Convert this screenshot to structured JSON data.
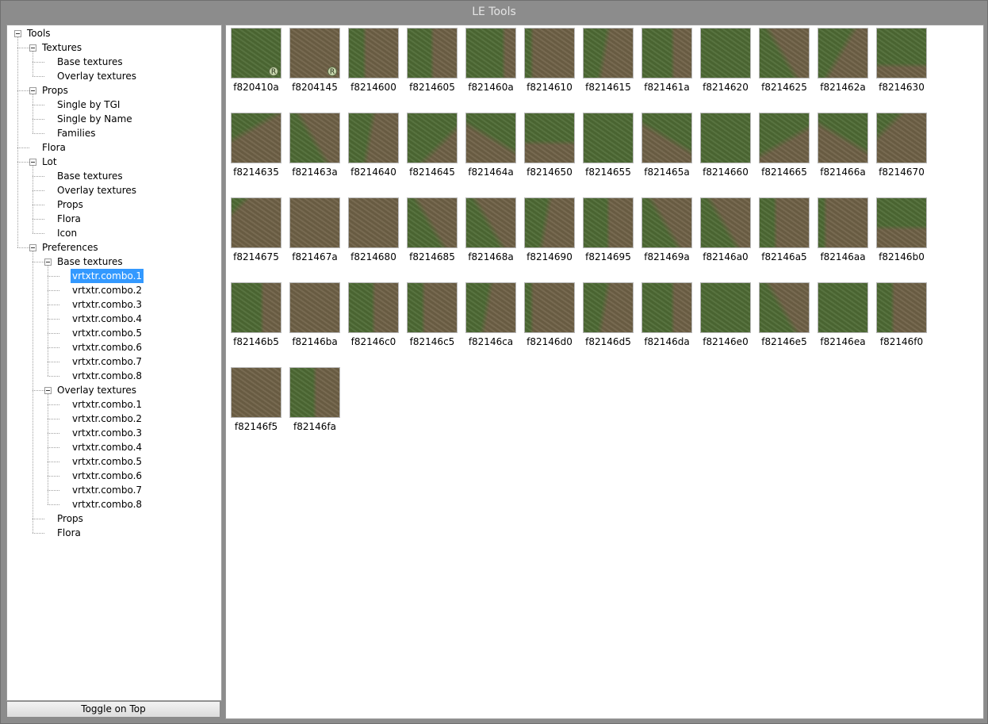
{
  "window": {
    "title": "LE Tools"
  },
  "toggle_button": {
    "label": "Toggle on Top"
  },
  "tree": [
    {
      "id": "tools",
      "label": "Tools",
      "level": 0,
      "expanded": true
    },
    {
      "id": "textures",
      "label": "Textures",
      "level": 1,
      "expanded": true
    },
    {
      "id": "textures-base",
      "label": "Base textures",
      "level": 2
    },
    {
      "id": "textures-overlay",
      "label": "Overlay textures",
      "level": 2
    },
    {
      "id": "props",
      "label": "Props",
      "level": 1,
      "expanded": true
    },
    {
      "id": "props-tgi",
      "label": "Single by TGI",
      "level": 2
    },
    {
      "id": "props-name",
      "label": "Single by Name",
      "level": 2
    },
    {
      "id": "props-families",
      "label": "Families",
      "level": 2
    },
    {
      "id": "flora",
      "label": "Flora",
      "level": 1
    },
    {
      "id": "lot",
      "label": "Lot",
      "level": 1,
      "expanded": true
    },
    {
      "id": "lot-base",
      "label": "Base textures",
      "level": 2
    },
    {
      "id": "lot-overlay",
      "label": "Overlay textures",
      "level": 2
    },
    {
      "id": "lot-props",
      "label": "Props",
      "level": 2
    },
    {
      "id": "lot-flora",
      "label": "Flora",
      "level": 2
    },
    {
      "id": "lot-icon",
      "label": "Icon",
      "level": 2
    },
    {
      "id": "prefs",
      "label": "Preferences",
      "level": 1,
      "expanded": true
    },
    {
      "id": "prefs-base",
      "label": "Base textures",
      "level": 2,
      "expanded": true
    },
    {
      "id": "pb1",
      "label": "vrtxtr.combo.1",
      "level": 3,
      "selected": true
    },
    {
      "id": "pb2",
      "label": "vrtxtr.combo.2",
      "level": 3
    },
    {
      "id": "pb3",
      "label": "vrtxtr.combo.3",
      "level": 3
    },
    {
      "id": "pb4",
      "label": "vrtxtr.combo.4",
      "level": 3
    },
    {
      "id": "pb5",
      "label": "vrtxtr.combo.5",
      "level": 3
    },
    {
      "id": "pb6",
      "label": "vrtxtr.combo.6",
      "level": 3
    },
    {
      "id": "pb7",
      "label": "vrtxtr.combo.7",
      "level": 3
    },
    {
      "id": "pb8",
      "label": "vrtxtr.combo.8",
      "level": 3
    },
    {
      "id": "prefs-overlay",
      "label": "Overlay textures",
      "level": 2,
      "expanded": true
    },
    {
      "id": "po1",
      "label": "vrtxtr.combo.1",
      "level": 3
    },
    {
      "id": "po2",
      "label": "vrtxtr.combo.2",
      "level": 3
    },
    {
      "id": "po3",
      "label": "vrtxtr.combo.3",
      "level": 3
    },
    {
      "id": "po4",
      "label": "vrtxtr.combo.4",
      "level": 3
    },
    {
      "id": "po5",
      "label": "vrtxtr.combo.5",
      "level": 3
    },
    {
      "id": "po6",
      "label": "vrtxtr.combo.6",
      "level": 3
    },
    {
      "id": "po7",
      "label": "vrtxtr.combo.7",
      "level": 3
    },
    {
      "id": "po8",
      "label": "vrtxtr.combo.8",
      "level": 3
    },
    {
      "id": "prefs-props",
      "label": "Props",
      "level": 2
    },
    {
      "id": "prefs-flora",
      "label": "Flora",
      "level": 2
    }
  ],
  "colors": {
    "grass": "#4e6a34",
    "dirt": "#6f6146",
    "selection": "#3399ff"
  },
  "textures": [
    {
      "label": "f820410a",
      "badge": "R",
      "pattern": "grass"
    },
    {
      "label": "f8204145",
      "badge": "R",
      "pattern": "dirt"
    },
    {
      "label": "f8214600",
      "pattern": "grass-left-strip"
    },
    {
      "label": "f8214605",
      "pattern": "grass-left-wide"
    },
    {
      "label": "f821460a",
      "pattern": "grass-right-strip"
    },
    {
      "label": "f8214610",
      "pattern": "dirt-left-thin"
    },
    {
      "label": "f8214615",
      "pattern": "grass-left-mid"
    },
    {
      "label": "f821461a",
      "pattern": "grass-right-mid"
    },
    {
      "label": "f8214620",
      "pattern": "grass"
    },
    {
      "label": "f8214625",
      "pattern": "grass-diag-left"
    },
    {
      "label": "f821462a",
      "pattern": "grass-diag-right"
    },
    {
      "label": "f8214630",
      "pattern": "grass-bottom"
    },
    {
      "label": "f8214635",
      "pattern": "grass-top-diag"
    },
    {
      "label": "f821463a",
      "pattern": "grass-diag-left"
    },
    {
      "label": "f8214640",
      "pattern": "grass-left-mid"
    },
    {
      "label": "f8214645",
      "pattern": "grass-bottom-right"
    },
    {
      "label": "f821464a",
      "pattern": "grass-top-right"
    },
    {
      "label": "f8214650",
      "pattern": "grass-top"
    },
    {
      "label": "f8214655",
      "pattern": "grass"
    },
    {
      "label": "f821465a",
      "pattern": "grass-top-right"
    },
    {
      "label": "f8214660",
      "pattern": "grass"
    },
    {
      "label": "f8214665",
      "pattern": "grass-top-left"
    },
    {
      "label": "f821466a",
      "pattern": "grass-top-right"
    },
    {
      "label": "f8214670",
      "pattern": "grass-top-corner"
    },
    {
      "label": "f8214675",
      "pattern": "dirt-top-left"
    },
    {
      "label": "f821467a",
      "pattern": "dirt"
    },
    {
      "label": "f8214680",
      "pattern": "dirt"
    },
    {
      "label": "f8214685",
      "pattern": "grass-diag-left"
    },
    {
      "label": "f821468a",
      "pattern": "grass-diag-left"
    },
    {
      "label": "f8214690",
      "pattern": "grass-left-mid"
    },
    {
      "label": "f8214695",
      "pattern": "grass-left-wide"
    },
    {
      "label": "f821469a",
      "pattern": "grass-diag-left"
    },
    {
      "label": "f82146a0",
      "pattern": "grass-diag-left"
    },
    {
      "label": "f82146a5",
      "pattern": "grass-left-strip"
    },
    {
      "label": "f82146aa",
      "pattern": "dirt-left-thin"
    },
    {
      "label": "f82146b0",
      "pattern": "grass-top"
    },
    {
      "label": "f82146b5",
      "pattern": "grass-right-mid"
    },
    {
      "label": "f82146ba",
      "pattern": "dirt"
    },
    {
      "label": "f82146c0",
      "pattern": "grass-left-wide"
    },
    {
      "label": "f82146c5",
      "pattern": "grass-left-strip"
    },
    {
      "label": "f82146ca",
      "pattern": "grass-left-mid"
    },
    {
      "label": "f82146d0",
      "pattern": "dirt-left-thin"
    },
    {
      "label": "f82146d5",
      "pattern": "grass-left-mid"
    },
    {
      "label": "f82146da",
      "pattern": "grass-right-mid"
    },
    {
      "label": "f82146e0",
      "pattern": "grass"
    },
    {
      "label": "f82146e5",
      "pattern": "grass-diag-left"
    },
    {
      "label": "f82146ea",
      "pattern": "grass"
    },
    {
      "label": "f82146f0",
      "pattern": "grass-left-strip"
    },
    {
      "label": "f82146f5",
      "pattern": "dirt"
    },
    {
      "label": "f82146fa",
      "pattern": "grass-left-wide"
    }
  ]
}
